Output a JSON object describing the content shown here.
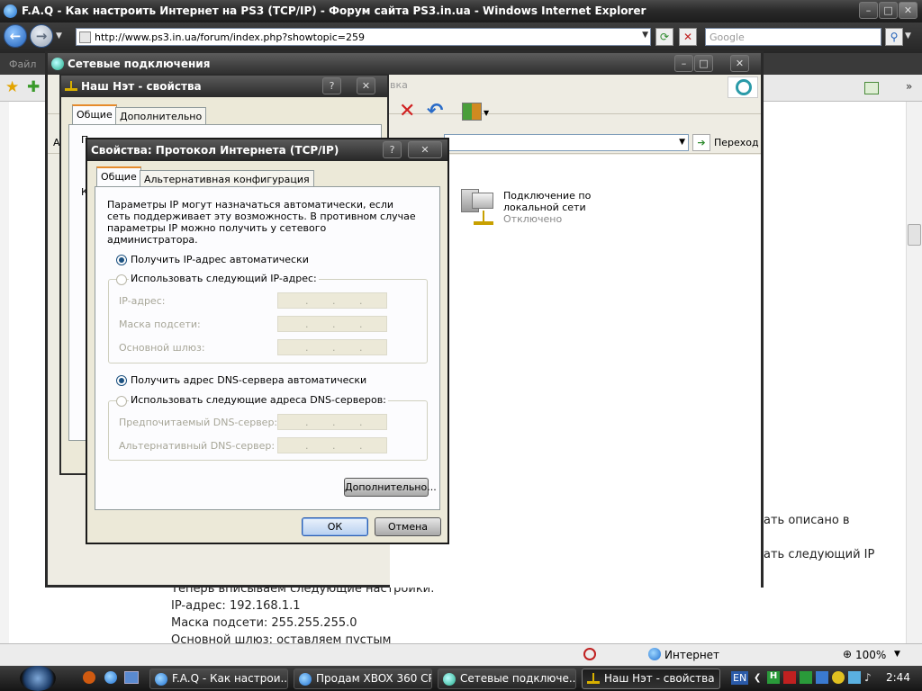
{
  "ie": {
    "title": "F.A.Q - Как настроить Интернет на PS3 (TCP/IP) - Форум сайта PS3.in.ua - Windows Internet Explorer",
    "url": "http://www.ps3.in.ua/forum/index.php?showtopic=259",
    "search_placeholder": "Google",
    "menu_file": "Файл",
    "status_zone": "Интернет",
    "zoom": "100%"
  },
  "page": {
    "line1": "ать описано в",
    "line2": "ать следующий IP",
    "line3": "Теперь вписываем следующие настройки:",
    "line4": "IP-адрес: 192.168.1.1",
    "line5": "Маска подсети: 255.255.255.0",
    "line6": "Основной шлюз: оставляем пустым"
  },
  "netwin": {
    "title": "Сетевые подключения",
    "toolbar_fragment": "вка",
    "address_prefix": "Ад",
    "go_label": "Переход",
    "connection_name": "Подключение по локальной сети",
    "connection_status": "Отключено"
  },
  "propwin": {
    "title": "Наш Нэт - свойства",
    "tab_general": "Общие",
    "tab_advanced": "Дополнительно",
    "frag1": "П",
    "frag2": "К"
  },
  "tcp": {
    "title": "Свойства: Протокол Интернета (TCP/IP)",
    "help_btn": "?",
    "tab_general": "Общие",
    "tab_alt": "Альтернативная конфигурация",
    "description": "Параметры IP могут назначаться автоматически, если сеть поддерживает эту возможность. В противном случае параметры IP можно получить у сетевого администратора.",
    "radio_auto_ip": "Получить IP-адрес автоматически",
    "radio_manual_ip": "Использовать следующий IP-адрес:",
    "ip_label": "IP-адрес:",
    "mask_label": "Маска подсети:",
    "gw_label": "Основной шлюз:",
    "radio_auto_dns": "Получить адрес DNS-сервера автоматически",
    "radio_manual_dns": "Использовать следующие адреса DNS-серверов:",
    "dns1_label": "Предпочитаемый DNS-сервер:",
    "dns2_label": "Альтернативный DNS-сервер:",
    "advanced_btn": "Дополнительно...",
    "ok_btn": "ОК",
    "cancel_btn": "Отмена"
  },
  "taskbar": {
    "items": [
      "F.A.Q - Как настрои...",
      "Продам XBOX 360 СР...",
      "Сетевые подключе...",
      "Наш Нэт - свойства"
    ],
    "lang": "EN",
    "time": "2:44"
  }
}
